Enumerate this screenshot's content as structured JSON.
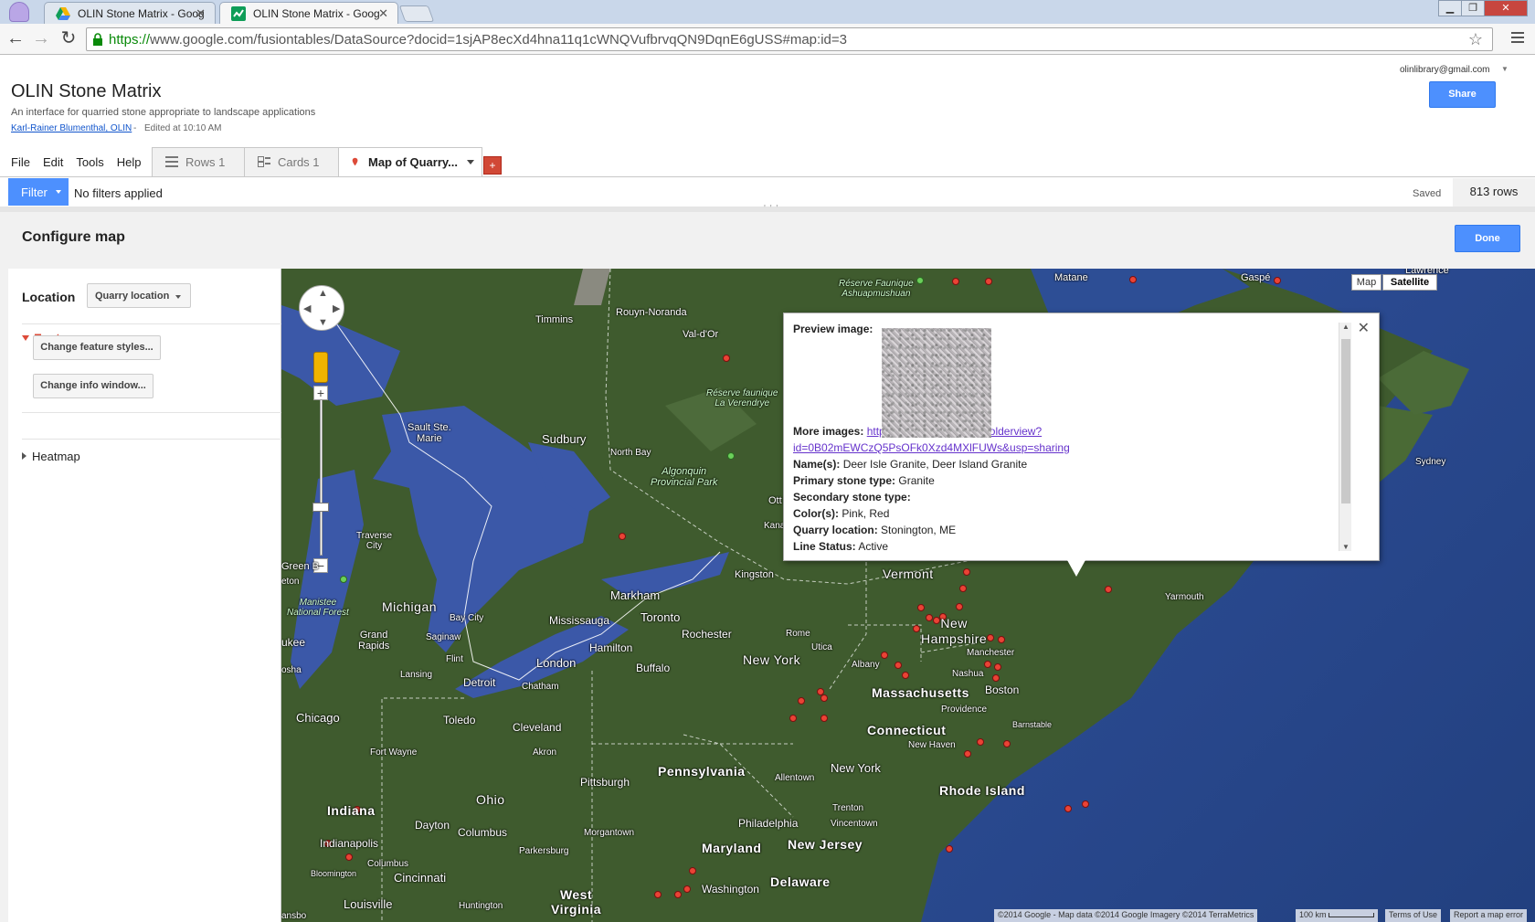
{
  "browser": {
    "tabs": [
      {
        "title": "OLIN Stone Matrix - Goog"
      },
      {
        "title": "OLIN Stone Matrix - Goog"
      }
    ],
    "url_scheme": "https://",
    "url_rest": "www.google.com/fusiontables/DataSource?docid=1sjAP8ecXd4hna11q1cWNQVufbrvqQN9DqnE6gUSS#map:id=3"
  },
  "doc": {
    "title": "OLIN Stone Matrix",
    "description": "An interface for quarried stone appropriate to landscape applications",
    "author": "Karl-Rainer Blumenthal, OLIN",
    "separator": "-",
    "edited": "Edited at 10:10 AM",
    "account": "olinlibrary@gmail.com",
    "share_label": "Share"
  },
  "menu": [
    "File",
    "Edit",
    "Tools",
    "Help"
  ],
  "view_tabs": [
    {
      "label": "Rows 1"
    },
    {
      "label": "Cards 1"
    },
    {
      "label": "Map of Quarry..."
    }
  ],
  "add_tab_label": "+",
  "filter": {
    "button_label": "Filter",
    "status": "No filters applied",
    "saved": "Saved",
    "row_count": "813 rows"
  },
  "configure": {
    "title": "Configure map",
    "done_label": "Done",
    "location_label": "Location",
    "location_value": "Quarry location",
    "feature_map_label": "Feature map",
    "change_styles_label": "Change feature styles...",
    "change_info_label": "Change info window...",
    "heatmap_label": "Heatmap"
  },
  "map": {
    "map_type": {
      "map": "Map",
      "satellite": "Satellite",
      "selected": "Satellite"
    },
    "labels": {
      "matane": "Matane",
      "gaspe": "Gaspé",
      "lawrence": "Lawrence",
      "timmins": "Timmins",
      "rouyn": "Rouyn-Noranda",
      "valdor": "Val-d'Or",
      "reserve_ashuap": "Réserve Faunique\nAshuapmushuan",
      "reserve_verendrye": "Réserve faunique\nLa Verendrye",
      "sault": "Sault Ste.\nMarie",
      "sudbury": "Sudbury",
      "northbay": "North Bay",
      "algonquin": "Algonquin\nProvincial Park",
      "ott": "Ott",
      "kana": "Kana",
      "sydney": "Sydney",
      "traverse": "Traverse\nCity",
      "greenb": "Green B",
      "manistee": "Manistee\nNational Forest",
      "michigan": "Michigan",
      "baycity": "Bay City",
      "saginaw": "Saginaw",
      "grandrapids": "Grand\nRapids",
      "flint": "Flint",
      "lansing": "Lansing",
      "detroit": "Detroit",
      "kingston": "Kingston",
      "markham": "Markham",
      "mississauga": "Mississauga",
      "toronto": "Toronto",
      "hamilton": "Hamilton",
      "london": "London",
      "chatham": "Chatham",
      "rochester": "Rochester",
      "buffalo": "Buffalo",
      "rome": "Rome",
      "utica": "Utica",
      "newyork_state": "New York",
      "vermont": "Vermont",
      "newhampshire": "New\nHampshire",
      "manchester": "Manchester",
      "yarmouth": "Yarmouth",
      "albany": "Albany",
      "nashua": "Nashua",
      "massachusetts": "Massachusetts",
      "boston": "Boston",
      "providence": "Providence",
      "connecticut": "Connecticut",
      "barnstable": "Barnstable",
      "newhaven": "New Haven",
      "chicago": "Chicago",
      "toledo": "Toledo",
      "cleveland": "Cleveland",
      "akron": "Akron",
      "fortwayne": "Fort Wayne",
      "pennsylvania": "Pennsylvania",
      "allentown": "Allentown",
      "newyork_city": "New York",
      "rhodeisland": "Rhode Island",
      "pittsburgh": "Pittsburgh",
      "ohio": "Ohio",
      "indiana": "Indiana",
      "dayton": "Dayton",
      "columbus_oh": "Columbus",
      "trenton": "Trenton",
      "philadelphia": "Philadelphia",
      "vincentown": "Vincentown",
      "morgantown": "Morgantown",
      "maryland": "Maryland",
      "newjersey": "New Jersey",
      "indianapolis": "Indianapolis",
      "parkersburg": "Parkersburg",
      "columbus_in": "Columbus",
      "bloomington": "Bloomington",
      "cincinnati": "Cincinnati",
      "washington": "Washington",
      "delaware": "Delaware",
      "westvirginia": "West\nVirginia",
      "huntington": "Huntington",
      "louisville": "Louisville",
      "ukee": "ukee",
      "osha": "osha",
      "eton": "eton",
      "nsbo": "ansbo"
    },
    "attribution": {
      "data": "©2014 Google - Map data ©2014 Google Imagery ©2014 TerraMetrics",
      "scale": "100 km",
      "terms": "Terms of Use",
      "report": "Report a map error"
    }
  },
  "info_window": {
    "preview_label": "Preview image:",
    "more_images_label": "More images:",
    "more_images_link_1": "https://drive.google.com/folderview?",
    "more_images_link_2": "id=0B02mEWCzQ5PsOFk0Xzd4MXlFUWs&usp=sharing",
    "names_label": "Name(s):",
    "names_value": "Deer Isle Granite, Deer Island Granite",
    "primary_label": "Primary stone type:",
    "primary_value": "Granite",
    "secondary_label": "Secondary stone type:",
    "secondary_value": "",
    "color_label": "Color(s):",
    "color_value": "Pink, Red",
    "quarry_label": "Quarry location:",
    "quarry_value": "Stonington, ME",
    "status_label": "Line Status:",
    "status_value": "Active"
  },
  "colors": {
    "accent_blue": "#4d90fe",
    "feature_red": "#dd4b39",
    "marker_red": "#ea4335",
    "water": "#3b58a8",
    "land": "#3f5b2e"
  }
}
